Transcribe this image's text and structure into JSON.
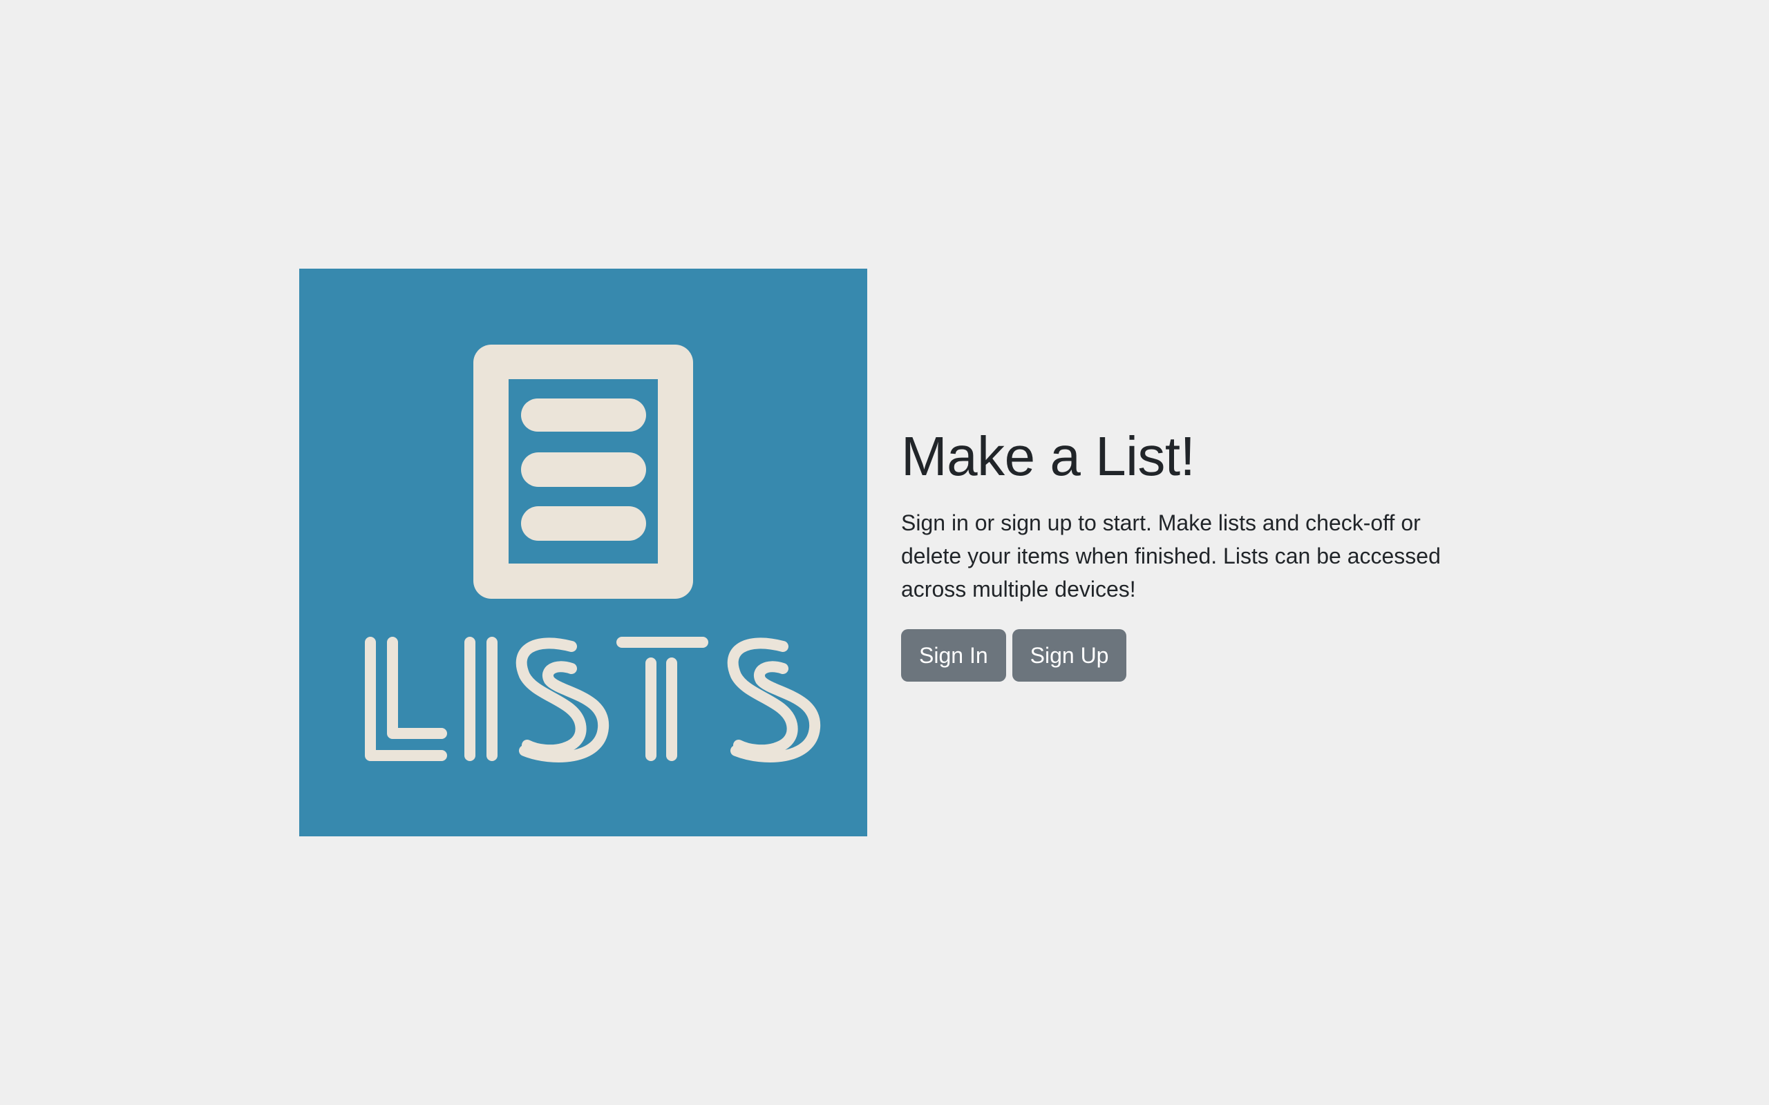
{
  "logo": {
    "wordmark": "LISTS",
    "icon": "list-document-icon",
    "bg_color": "#3789ae",
    "fg_color": "#ebe4d9"
  },
  "hero": {
    "title": "Make a List!",
    "description": "Sign in or sign up to start. Make lists and check-off or delete your items when finished. Lists can be accessed across multiple devices!"
  },
  "buttons": {
    "sign_in": "Sign In",
    "sign_up": "Sign Up"
  },
  "colors": {
    "page_bg": "#efefef",
    "button_bg": "#6c757d",
    "text": "#212529"
  }
}
